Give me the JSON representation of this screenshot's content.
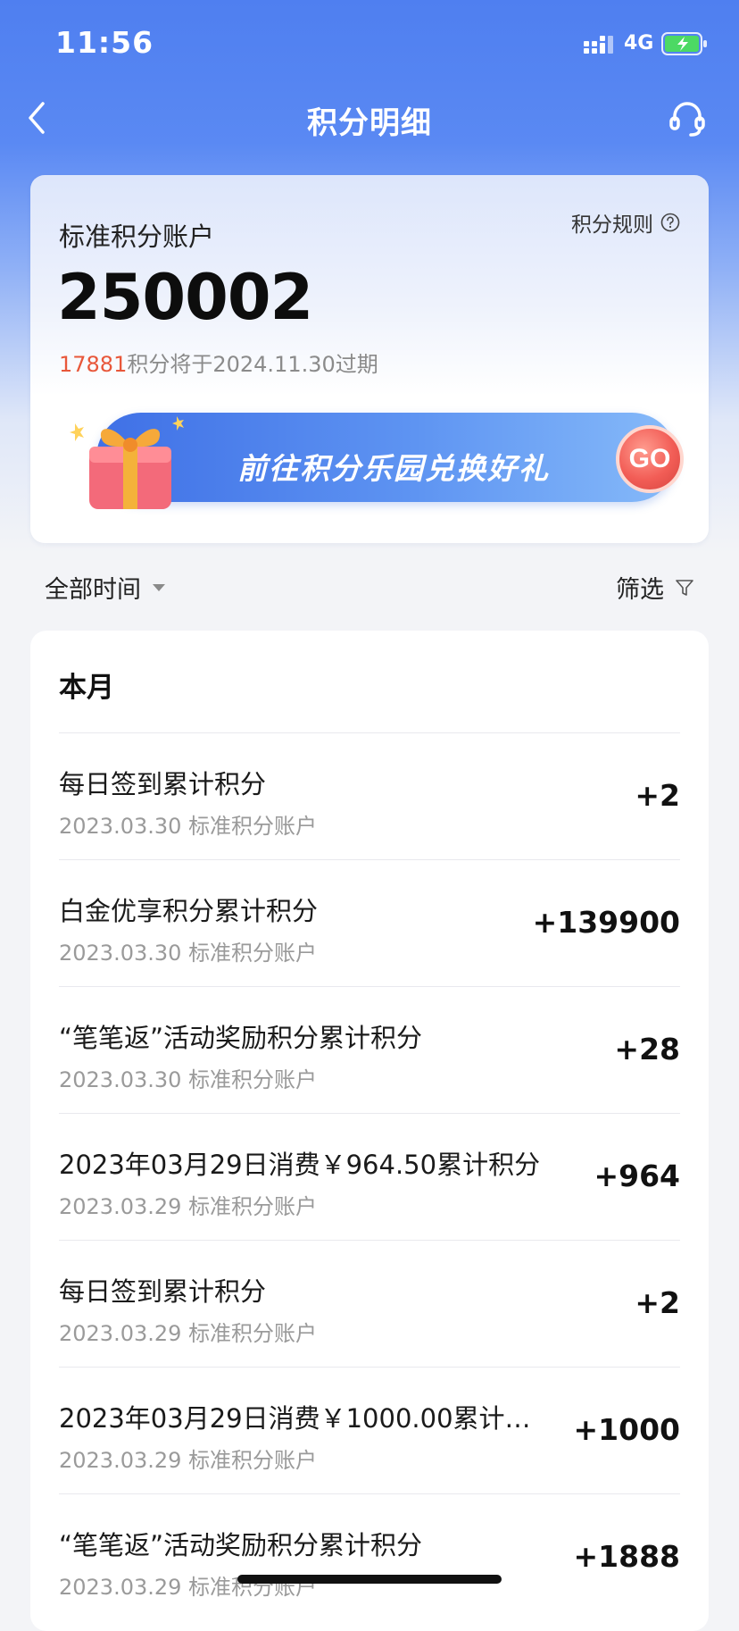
{
  "status_bar": {
    "time": "11:56",
    "network": "4G"
  },
  "nav": {
    "title": "积分明细"
  },
  "account": {
    "label": "标准积分账户",
    "rules_label": "积分规则",
    "balance": "250002",
    "expiring_points": "17881",
    "expiring_text": "积分将于2024.11.30过期"
  },
  "banner": {
    "text": "前往积分乐园兑换好礼",
    "go_label": "GO"
  },
  "filters": {
    "time_label": "全部时间",
    "filter_label": "筛选"
  },
  "records": {
    "section_title": "本月",
    "items": [
      {
        "title": "每日签到累计积分",
        "date": "2023.03.30",
        "account": "标准积分账户",
        "amount": "+2"
      },
      {
        "title": "白金优享积分累计积分",
        "date": "2023.03.30",
        "account": "标准积分账户",
        "amount": "+139900"
      },
      {
        "title": "“笔笔返”活动奖励积分累计积分",
        "date": "2023.03.30",
        "account": "标准积分账户",
        "amount": "+28"
      },
      {
        "title": "2023年03月29日消费￥964.50累计积分",
        "date": "2023.03.29",
        "account": "标准积分账户",
        "amount": "+964"
      },
      {
        "title": "每日签到累计积分",
        "date": "2023.03.29",
        "account": "标准积分账户",
        "amount": "+2"
      },
      {
        "title": "2023年03月29日消费￥1000.00累计…",
        "date": "2023.03.29",
        "account": "标准积分账户",
        "amount": "+1000"
      },
      {
        "title": "“笔笔返”活动奖励积分累计积分",
        "date": "2023.03.29",
        "account": "标准积分账户",
        "amount": "+1888"
      }
    ]
  },
  "colors": {
    "header_blue": "#4f7ff0",
    "expire_red": "#e8573a",
    "go_red": "#f25d56"
  },
  "icons": {
    "back": "chevron-left-icon",
    "customer_service": "headset-icon",
    "rules_help": "question-circle-icon",
    "time_caret": "caret-down-icon",
    "filter": "funnel-icon",
    "gift": "gift-box-icon"
  }
}
